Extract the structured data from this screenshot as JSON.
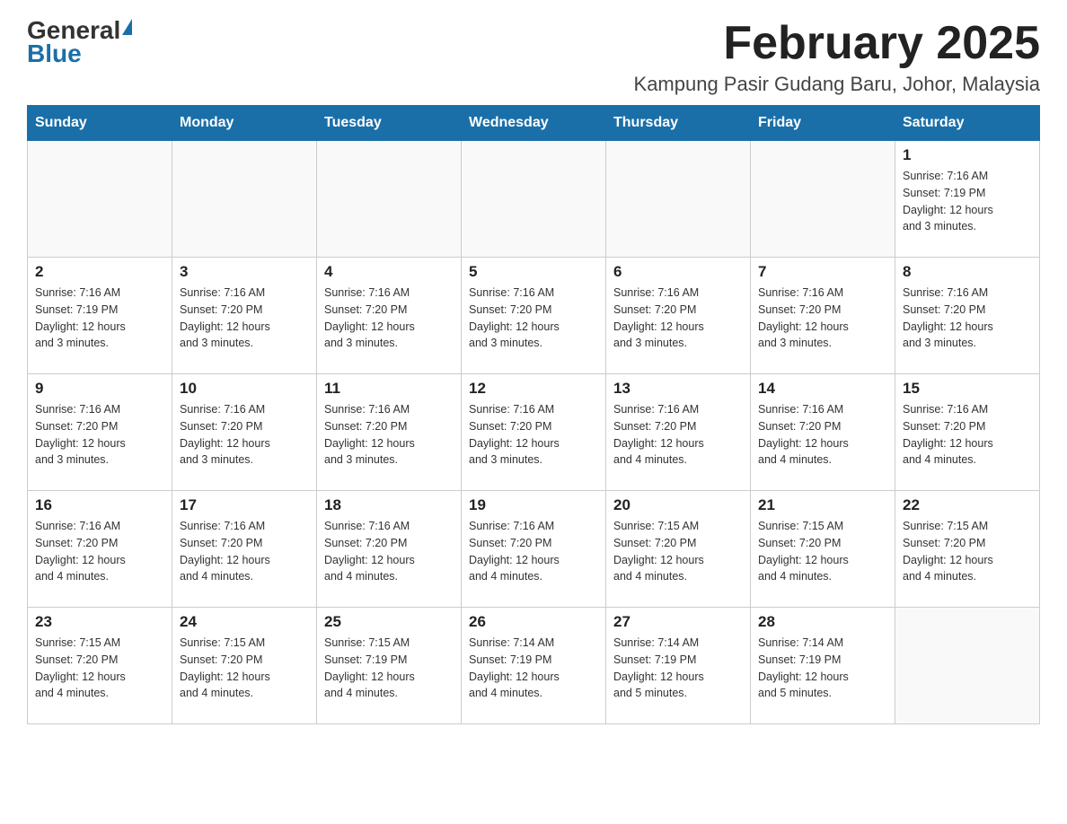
{
  "header": {
    "logo_general": "General",
    "logo_blue": "Blue",
    "month_title": "February 2025",
    "location": "Kampung Pasir Gudang Baru, Johor, Malaysia"
  },
  "days_of_week": [
    "Sunday",
    "Monday",
    "Tuesday",
    "Wednesday",
    "Thursday",
    "Friday",
    "Saturday"
  ],
  "weeks": [
    [
      {
        "day": "",
        "info": ""
      },
      {
        "day": "",
        "info": ""
      },
      {
        "day": "",
        "info": ""
      },
      {
        "day": "",
        "info": ""
      },
      {
        "day": "",
        "info": ""
      },
      {
        "day": "",
        "info": ""
      },
      {
        "day": "1",
        "info": "Sunrise: 7:16 AM\nSunset: 7:19 PM\nDaylight: 12 hours\nand 3 minutes."
      }
    ],
    [
      {
        "day": "2",
        "info": "Sunrise: 7:16 AM\nSunset: 7:19 PM\nDaylight: 12 hours\nand 3 minutes."
      },
      {
        "day": "3",
        "info": "Sunrise: 7:16 AM\nSunset: 7:20 PM\nDaylight: 12 hours\nand 3 minutes."
      },
      {
        "day": "4",
        "info": "Sunrise: 7:16 AM\nSunset: 7:20 PM\nDaylight: 12 hours\nand 3 minutes."
      },
      {
        "day": "5",
        "info": "Sunrise: 7:16 AM\nSunset: 7:20 PM\nDaylight: 12 hours\nand 3 minutes."
      },
      {
        "day": "6",
        "info": "Sunrise: 7:16 AM\nSunset: 7:20 PM\nDaylight: 12 hours\nand 3 minutes."
      },
      {
        "day": "7",
        "info": "Sunrise: 7:16 AM\nSunset: 7:20 PM\nDaylight: 12 hours\nand 3 minutes."
      },
      {
        "day": "8",
        "info": "Sunrise: 7:16 AM\nSunset: 7:20 PM\nDaylight: 12 hours\nand 3 minutes."
      }
    ],
    [
      {
        "day": "9",
        "info": "Sunrise: 7:16 AM\nSunset: 7:20 PM\nDaylight: 12 hours\nand 3 minutes."
      },
      {
        "day": "10",
        "info": "Sunrise: 7:16 AM\nSunset: 7:20 PM\nDaylight: 12 hours\nand 3 minutes."
      },
      {
        "day": "11",
        "info": "Sunrise: 7:16 AM\nSunset: 7:20 PM\nDaylight: 12 hours\nand 3 minutes."
      },
      {
        "day": "12",
        "info": "Sunrise: 7:16 AM\nSunset: 7:20 PM\nDaylight: 12 hours\nand 3 minutes."
      },
      {
        "day": "13",
        "info": "Sunrise: 7:16 AM\nSunset: 7:20 PM\nDaylight: 12 hours\nand 4 minutes."
      },
      {
        "day": "14",
        "info": "Sunrise: 7:16 AM\nSunset: 7:20 PM\nDaylight: 12 hours\nand 4 minutes."
      },
      {
        "day": "15",
        "info": "Sunrise: 7:16 AM\nSunset: 7:20 PM\nDaylight: 12 hours\nand 4 minutes."
      }
    ],
    [
      {
        "day": "16",
        "info": "Sunrise: 7:16 AM\nSunset: 7:20 PM\nDaylight: 12 hours\nand 4 minutes."
      },
      {
        "day": "17",
        "info": "Sunrise: 7:16 AM\nSunset: 7:20 PM\nDaylight: 12 hours\nand 4 minutes."
      },
      {
        "day": "18",
        "info": "Sunrise: 7:16 AM\nSunset: 7:20 PM\nDaylight: 12 hours\nand 4 minutes."
      },
      {
        "day": "19",
        "info": "Sunrise: 7:16 AM\nSunset: 7:20 PM\nDaylight: 12 hours\nand 4 minutes."
      },
      {
        "day": "20",
        "info": "Sunrise: 7:15 AM\nSunset: 7:20 PM\nDaylight: 12 hours\nand 4 minutes."
      },
      {
        "day": "21",
        "info": "Sunrise: 7:15 AM\nSunset: 7:20 PM\nDaylight: 12 hours\nand 4 minutes."
      },
      {
        "day": "22",
        "info": "Sunrise: 7:15 AM\nSunset: 7:20 PM\nDaylight: 12 hours\nand 4 minutes."
      }
    ],
    [
      {
        "day": "23",
        "info": "Sunrise: 7:15 AM\nSunset: 7:20 PM\nDaylight: 12 hours\nand 4 minutes."
      },
      {
        "day": "24",
        "info": "Sunrise: 7:15 AM\nSunset: 7:20 PM\nDaylight: 12 hours\nand 4 minutes."
      },
      {
        "day": "25",
        "info": "Sunrise: 7:15 AM\nSunset: 7:19 PM\nDaylight: 12 hours\nand 4 minutes."
      },
      {
        "day": "26",
        "info": "Sunrise: 7:14 AM\nSunset: 7:19 PM\nDaylight: 12 hours\nand 4 minutes."
      },
      {
        "day": "27",
        "info": "Sunrise: 7:14 AM\nSunset: 7:19 PM\nDaylight: 12 hours\nand 5 minutes."
      },
      {
        "day": "28",
        "info": "Sunrise: 7:14 AM\nSunset: 7:19 PM\nDaylight: 12 hours\nand 5 minutes."
      },
      {
        "day": "",
        "info": ""
      }
    ]
  ]
}
